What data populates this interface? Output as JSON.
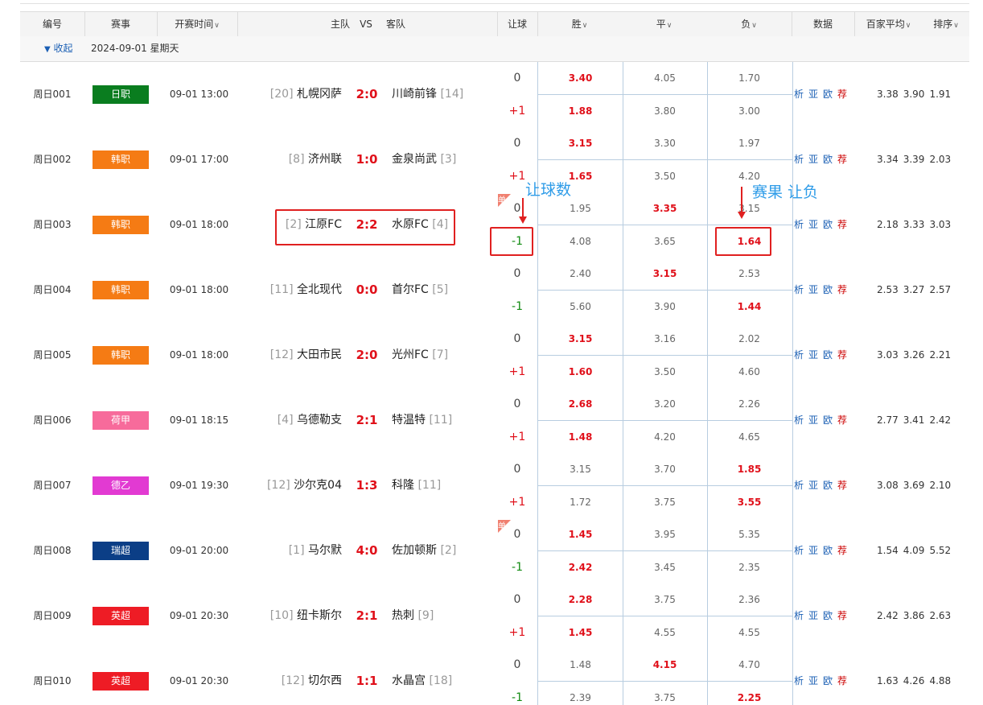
{
  "header": {
    "num": "编号",
    "league": "赛事",
    "time": "开赛时间",
    "home": "主队",
    "vs": "VS",
    "away": "客队",
    "handicap": "让球",
    "win": "胜",
    "draw": "平",
    "lose": "负",
    "data": "数据",
    "avg": "百家平均",
    "sort": "排序"
  },
  "date_row": {
    "toggle": "收起",
    "date": "2024-09-01 星期天"
  },
  "annotations": {
    "handicap": "让球数",
    "result": "赛果 让负",
    "single": "单"
  },
  "links": [
    "析",
    "亚",
    "欧",
    "荐"
  ],
  "colors": {
    "red": "#e0101a",
    "green": "#108a10",
    "link": "#1a5fb4",
    "annot": "#2f9ce8"
  },
  "matches": [
    {
      "num": "周日001",
      "league": "日职",
      "lcolor": "#0a7d1f",
      "time": "09-01 13:00",
      "hrank": "[20]",
      "home": "札幌冈萨",
      "score": "2:0",
      "away": "川崎前锋",
      "arank": "[14]",
      "h1": "0",
      "h2": "+1",
      "o1": [
        "3.40",
        "4.05",
        "1.70"
      ],
      "o2": [
        "1.88",
        "3.80",
        "3.00"
      ],
      "r1": 0,
      "r2": 0,
      "avg": [
        "3.38",
        "3.90",
        "1.91"
      ],
      "dan": false
    },
    {
      "num": "周日002",
      "league": "韩职",
      "lcolor": "#f57b14",
      "time": "09-01 17:00",
      "hrank": "[8]",
      "home": "济州联",
      "score": "1:0",
      "away": "金泉尚武",
      "arank": "[3]",
      "h1": "0",
      "h2": "+1",
      "o1": [
        "3.15",
        "3.30",
        "1.97"
      ],
      "o2": [
        "1.65",
        "3.50",
        "4.20"
      ],
      "r1": 0,
      "r2": 0,
      "avg": [
        "3.34",
        "3.39",
        "2.03"
      ],
      "dan": false
    },
    {
      "num": "周日003",
      "league": "韩职",
      "lcolor": "#f57b14",
      "time": "09-01 18:00",
      "hrank": "[2]",
      "home": "江原FC",
      "score": "2:2",
      "away": "水原FC",
      "arank": "[4]",
      "h1": "0",
      "h2": "-1",
      "o1": [
        "1.95",
        "3.35",
        "3.15"
      ],
      "o2": [
        "4.08",
        "3.65",
        "1.64"
      ],
      "r1": 1,
      "r2": 2,
      "avg": [
        "2.18",
        "3.33",
        "3.03"
      ],
      "dan": true
    },
    {
      "num": "周日004",
      "league": "韩职",
      "lcolor": "#f57b14",
      "time": "09-01 18:00",
      "hrank": "[11]",
      "home": "全北现代",
      "score": "0:0",
      "away": "首尔FC",
      "arank": "[5]",
      "h1": "0",
      "h2": "-1",
      "o1": [
        "2.40",
        "3.15",
        "2.53"
      ],
      "o2": [
        "5.60",
        "3.90",
        "1.44"
      ],
      "r1": 1,
      "r2": 2,
      "avg": [
        "2.53",
        "3.27",
        "2.57"
      ],
      "dan": false
    },
    {
      "num": "周日005",
      "league": "韩职",
      "lcolor": "#f57b14",
      "time": "09-01 18:00",
      "hrank": "[12]",
      "home": "大田市民",
      "score": "2:0",
      "away": "光州FC",
      "arank": "[7]",
      "h1": "0",
      "h2": "+1",
      "o1": [
        "3.15",
        "3.16",
        "2.02"
      ],
      "o2": [
        "1.60",
        "3.50",
        "4.60"
      ],
      "r1": 0,
      "r2": 0,
      "avg": [
        "3.03",
        "3.26",
        "2.21"
      ],
      "dan": false
    },
    {
      "num": "周日006",
      "league": "荷甲",
      "lcolor": "#f76b9b",
      "time": "09-01 18:15",
      "hrank": "[4]",
      "home": "乌德勒支",
      "score": "2:1",
      "away": "特温特",
      "arank": "[11]",
      "h1": "0",
      "h2": "+1",
      "o1": [
        "2.68",
        "3.20",
        "2.26"
      ],
      "o2": [
        "1.48",
        "4.20",
        "4.65"
      ],
      "r1": 0,
      "r2": 0,
      "avg": [
        "2.77",
        "3.41",
        "2.42"
      ],
      "dan": false
    },
    {
      "num": "周日007",
      "league": "德乙",
      "lcolor": "#e23ad2",
      "time": "09-01 19:30",
      "hrank": "[12]",
      "home": "沙尔克04",
      "score": "1:3",
      "away": "科隆",
      "arank": "[11]",
      "h1": "0",
      "h2": "+1",
      "o1": [
        "3.15",
        "3.70",
        "1.85"
      ],
      "o2": [
        "1.72",
        "3.75",
        "3.55"
      ],
      "r1": 2,
      "r2": 2,
      "avg": [
        "3.08",
        "3.69",
        "2.10"
      ],
      "dan": false
    },
    {
      "num": "周日008",
      "league": "瑞超",
      "lcolor": "#0b3e86",
      "time": "09-01 20:00",
      "hrank": "[1]",
      "home": "马尔默",
      "score": "4:0",
      "away": "佐加顿斯",
      "arank": "[2]",
      "h1": "0",
      "h2": "-1",
      "o1": [
        "1.45",
        "3.95",
        "5.35"
      ],
      "o2": [
        "2.42",
        "3.45",
        "2.35"
      ],
      "r1": 0,
      "r2": 0,
      "avg": [
        "1.54",
        "4.09",
        "5.52"
      ],
      "dan": true
    },
    {
      "num": "周日009",
      "league": "英超",
      "lcolor": "#ee1c25",
      "time": "09-01 20:30",
      "hrank": "[10]",
      "home": "纽卡斯尔",
      "score": "2:1",
      "away": "热刺",
      "arank": "[9]",
      "h1": "0",
      "h2": "+1",
      "o1": [
        "2.28",
        "3.75",
        "2.36"
      ],
      "o2": [
        "1.45",
        "4.55",
        "4.55"
      ],
      "r1": 0,
      "r2": 0,
      "avg": [
        "2.42",
        "3.86",
        "2.63"
      ],
      "dan": false
    },
    {
      "num": "周日010",
      "league": "英超",
      "lcolor": "#ee1c25",
      "time": "09-01 20:30",
      "hrank": "[12]",
      "home": "切尔西",
      "score": "1:1",
      "away": "水晶宫",
      "arank": "[18]",
      "h1": "0",
      "h2": "-1",
      "o1": [
        "1.48",
        "4.15",
        "4.70"
      ],
      "o2": [
        "2.39",
        "3.75",
        "2.25"
      ],
      "r1": 1,
      "r2": 2,
      "avg": [
        "1.63",
        "4.26",
        "4.88"
      ],
      "dan": false
    }
  ]
}
